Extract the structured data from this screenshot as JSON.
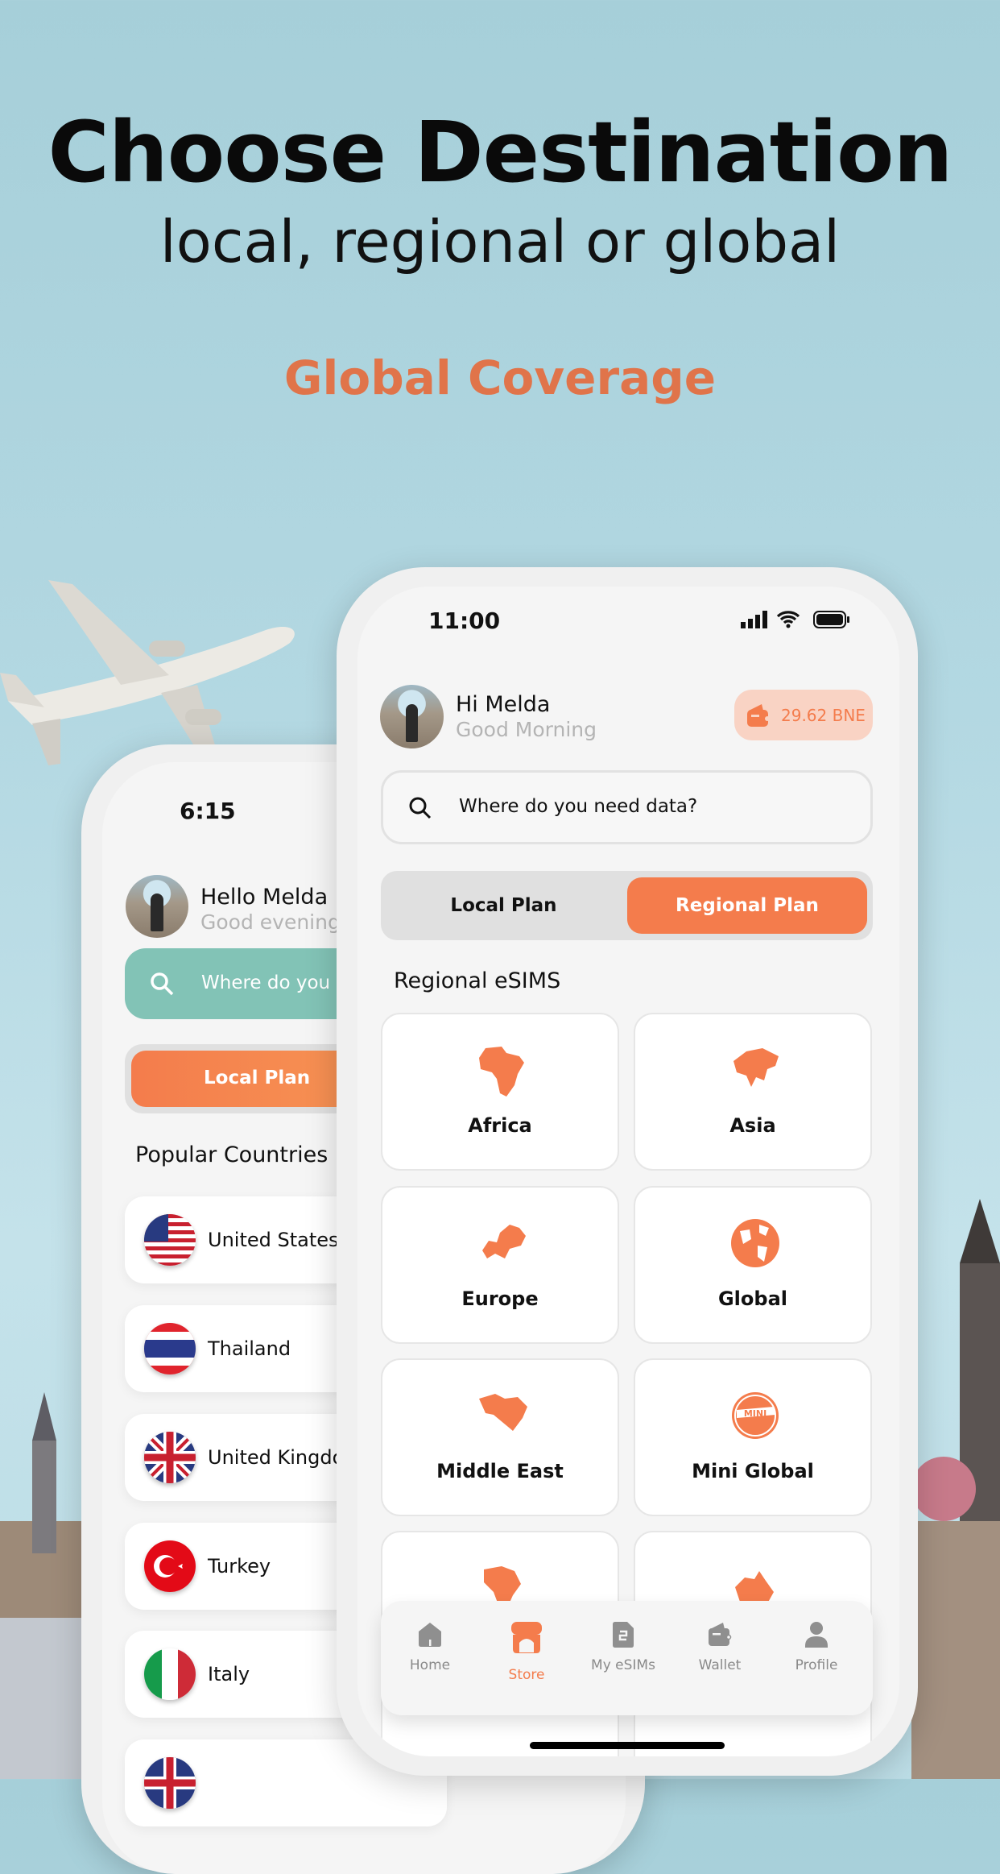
{
  "hero": {
    "title": "Choose Destination",
    "subtitle": "local, regional or global",
    "tagline": "Global Coverage"
  },
  "colors": {
    "accent": "#f47c4c",
    "teal": "#7fc3b6",
    "sky": "#a6cfd9"
  },
  "back_phone": {
    "status_time": "6:15",
    "greeting_name": "Hello Melda",
    "greeting_sub": "Good evening",
    "search_placeholder": "Where do you need data?",
    "plan_toggle_active": "Local Plan",
    "section_title": "Popular Countries",
    "countries": [
      {
        "name": "United States",
        "flag": "us"
      },
      {
        "name": "Thailand",
        "flag": "th"
      },
      {
        "name": "United Kingdom",
        "flag": "gb"
      },
      {
        "name": "Turkey",
        "flag": "tr"
      },
      {
        "name": "Italy",
        "flag": "it"
      }
    ]
  },
  "front_phone": {
    "status_time": "11:00",
    "greeting_name": "Hi Melda",
    "greeting_sub": "Good Morning",
    "wallet_balance": "29.62 BNE",
    "search_placeholder": "Where do you need data?",
    "tabs": [
      {
        "label": "Local Plan",
        "active": false
      },
      {
        "label": "Regional Plan",
        "active": true
      }
    ],
    "section_title": "Regional eSIMS",
    "regions": [
      {
        "label": "Africa",
        "icon": "africa-map-icon"
      },
      {
        "label": "Asia",
        "icon": "asia-map-icon"
      },
      {
        "label": "Europe",
        "icon": "europe-map-icon"
      },
      {
        "label": "Global",
        "icon": "globe-icon"
      },
      {
        "label": "Middle East",
        "icon": "middle-east-map-icon"
      },
      {
        "label": "Mini Global",
        "icon": "mini-globe-icon"
      }
    ],
    "nav": [
      {
        "label": "Home",
        "icon": "home-icon",
        "active": false
      },
      {
        "label": "Store",
        "icon": "store-icon",
        "active": true
      },
      {
        "label": "My eSIMs",
        "icon": "sim-card-icon",
        "active": false
      },
      {
        "label": "Wallet",
        "icon": "wallet-icon",
        "active": false
      },
      {
        "label": "Profile",
        "icon": "profile-icon",
        "active": false
      }
    ]
  }
}
